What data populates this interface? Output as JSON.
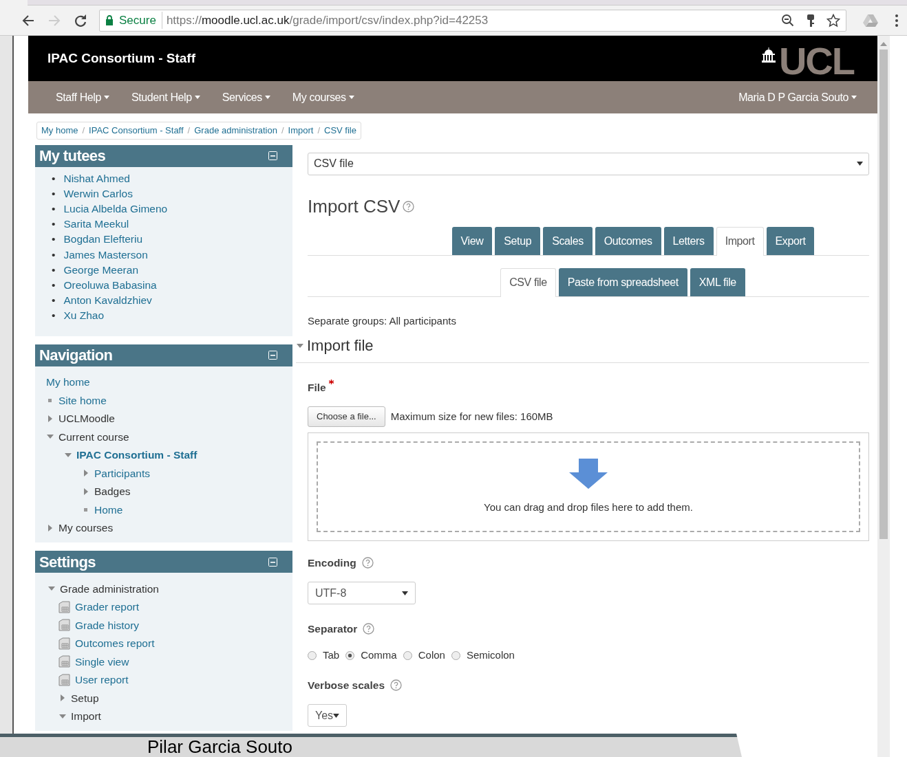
{
  "browser": {
    "secure_label": "Secure",
    "url": "https://**moodle.ucl.ac.uk**/grade/import/csv/index.php?id=42253",
    "forward_disabled": true
  },
  "header": {
    "site_title": "IPAC Consortium - Staff",
    "logo_text": "UCL"
  },
  "navbar": {
    "menus": [
      "Staff Help",
      "Student Help",
      "Services",
      "My courses"
    ],
    "user": "Maria D P Garcia Souto"
  },
  "breadcrumb": {
    "separator": "/",
    "items": [
      "My home",
      "IPAC Consortium - Staff",
      "Grade administration",
      "Import",
      "CSV file"
    ]
  },
  "blocks": [
    {
      "title": "My tutees",
      "kind": "list",
      "marker": "•",
      "items": [
        "Nishat Ahmed",
        "Werwin Carlos",
        "Lucia Albelda Gimeno",
        "Sarita Meekul",
        "Bogdan Elefteriu",
        "James Masterson",
        "George Meeran",
        "Oreoluwa Babasina",
        "Anton Kavaldzhiev",
        "Xu Zhao"
      ]
    },
    {
      "title": "Navigation",
      "kind": "tree",
      "items": [
        {
          "label": "My home",
          "kind": "plain",
          "link": true
        },
        {
          "label": "Site home",
          "kind": "leaf",
          "link": true
        },
        {
          "label": "UCLMoodle",
          "kind": "branch",
          "link": false,
          "expanded": false
        },
        {
          "label": "Current course",
          "kind": "branch",
          "link": false,
          "expanded": true,
          "children": [
            {
              "label": "IPAC Consortium - Staff",
              "kind": "branch",
              "link": true,
              "bold": true,
              "expanded": true,
              "children": [
                {
                  "label": "Participants",
                  "kind": "branch",
                  "link": true,
                  "expanded": false
                },
                {
                  "label": "Badges",
                  "kind": "branch",
                  "link": false,
                  "expanded": false
                },
                {
                  "label": "Home",
                  "kind": "leaf",
                  "link": true
                }
              ]
            }
          ]
        },
        {
          "label": "My courses",
          "kind": "branch",
          "link": false,
          "expanded": false
        }
      ]
    },
    {
      "title": "Settings",
      "kind": "tree",
      "items": [
        {
          "label": "Grade administration",
          "kind": "branch",
          "link": false,
          "expanded": true,
          "children": [
            {
              "label": "Grader report",
              "kind": "report",
              "link": true
            },
            {
              "label": "Grade history",
              "kind": "report",
              "link": true
            },
            {
              "label": "Outcomes report",
              "kind": "report",
              "link": true
            },
            {
              "label": "Single view",
              "kind": "report",
              "link": true
            },
            {
              "label": "User report",
              "kind": "report",
              "link": true
            },
            {
              "label": "Setup",
              "kind": "branch",
              "link": false,
              "expanded": false
            },
            {
              "label": "Import",
              "kind": "branch",
              "link": false,
              "expanded": true
            }
          ]
        }
      ]
    }
  ],
  "main": {
    "jump_select": "CSV file",
    "heading": "Import CSV",
    "tabs": [
      {
        "label": "View",
        "selected": false
      },
      {
        "label": "Setup",
        "selected": false
      },
      {
        "label": "Scales",
        "selected": false
      },
      {
        "label": "Outcomes",
        "selected": false
      },
      {
        "label": "Letters",
        "selected": false
      },
      {
        "label": "Import",
        "selected": true
      },
      {
        "label": "Export",
        "selected": false
      }
    ],
    "subtabs": [
      {
        "label": "CSV file",
        "selected": true
      },
      {
        "label": "Paste from spreadsheet",
        "selected": false
      },
      {
        "label": "XML file",
        "selected": false
      }
    ],
    "groups_text": "Separate groups: All participants",
    "section_title": "Import file",
    "file": {
      "label": "File",
      "required": true,
      "button": "Choose a file...",
      "max_size": "Maximum size for new files: 160MB",
      "drop_text": "You can drag and drop files here to add them."
    },
    "encoding": {
      "label": "Encoding",
      "value": "UTF-8"
    },
    "separator": {
      "label": "Separator",
      "options": [
        {
          "label": "Tab",
          "selected": false
        },
        {
          "label": "Comma",
          "selected": true
        },
        {
          "label": "Colon",
          "selected": false
        },
        {
          "label": "Semicolon",
          "selected": false
        }
      ]
    },
    "verbose": {
      "label": "Verbose scales",
      "value": "Yes"
    }
  },
  "caption": "Pilar Garcia Souto"
}
